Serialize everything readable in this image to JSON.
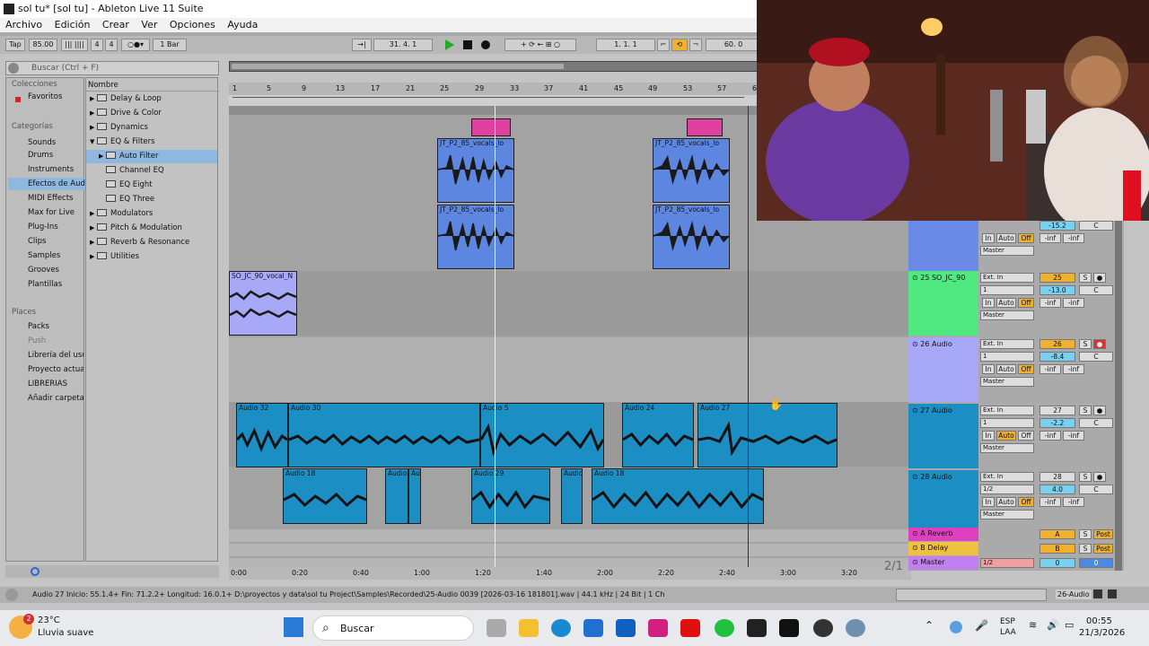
{
  "window": {
    "title": "sol tu*  [sol tu] - Ableton Live 11 Suite"
  },
  "menu": [
    "Archivo",
    "Edición",
    "Crear",
    "Ver",
    "Opciones",
    "Ayuda"
  ],
  "transport": {
    "tap": "Tap",
    "tempo": "85.00",
    "sig_num": "4",
    "sig_den": "4",
    "quant": "1 Bar",
    "position": "31.   4.   1",
    "loop_start": "1.   1.   1",
    "loop_len": "60.   0"
  },
  "browser": {
    "search_placeholder": "Buscar (Ctrl + F)",
    "collections_header": "Colecciones",
    "favorites": "Favoritos",
    "categories_header": "Categorías",
    "categories": [
      "Sounds",
      "Drums",
      "Instruments",
      "Efectos de Aud",
      "MIDI Effects",
      "Max for Live",
      "Plug-Ins",
      "Clips",
      "Samples",
      "Grooves",
      "Plantillas"
    ],
    "places_header": "Places",
    "places": [
      "Packs",
      "Push",
      "Librería del usu",
      "Proyecto actua",
      "LIBRERIAS",
      "Añadir carpeta..."
    ],
    "name_header": "Nombre",
    "items": [
      "Delay & Loop",
      "Drive & Color",
      "Dynamics",
      "EQ & Filters",
      "Auto Filter",
      "Channel EQ",
      "EQ Eight",
      "EQ Three",
      "Modulators",
      "Pitch & Modulation",
      "Reverb & Resonance",
      "Utilities"
    ]
  },
  "ruler": [
    "1",
    "5",
    "9",
    "13",
    "17",
    "21",
    "25",
    "29",
    "33",
    "37",
    "41",
    "45",
    "49",
    "53",
    "57",
    "6"
  ],
  "timeline": [
    "0:00",
    "0:20",
    "0:40",
    "1:00",
    "1:20",
    "1:40",
    "2:00",
    "2:20",
    "2:40",
    "3:00",
    "3:20"
  ],
  "clips": {
    "jt1": "JT_P2_85_vocals_lo",
    "jt2": "JT_P2_85_vocals_lo",
    "jt3": "JT_P2_85_vocals_lo",
    "jt4": "JT_P2_85_vocals_lo",
    "so": "SO_JC_90_vocal_N",
    "a32": "Audio 32",
    "a30": "Audio 30",
    "a5": "Audio 5",
    "a24": "Audio 24",
    "a27": "Audio 27",
    "a18a": "Audio 18",
    "a18b": "Audio 18",
    "au1": "Audio",
    "au2": "Au",
    "a29": "Audio 29",
    "au3": "Audio"
  },
  "mixer": {
    "tracks": [
      {
        "name": "25 SO_JC_90",
        "input": "Ext. In",
        "channel": "1",
        "monitor_in": "In",
        "monitor_auto": "Auto",
        "monitor_off": "Off",
        "output": "Master",
        "num": "25",
        "solo": "S",
        "vol": "-13.0",
        "pan": "C",
        "peak1": "-inf",
        "peak2": "-inf",
        "color": "#50e880"
      },
      {
        "name": "26 Audio",
        "input": "Ext. In",
        "channel": "1",
        "monitor_in": "In",
        "monitor_auto": "Auto",
        "monitor_off": "Off",
        "output": "Master",
        "num": "26",
        "solo": "S",
        "vol": "-8.4",
        "pan": "C",
        "peak1": "-inf",
        "peak2": "-inf",
        "color": "#a8a8f8"
      },
      {
        "name": "27 Audio",
        "input": "Ext. In",
        "channel": "1",
        "monitor_in": "In",
        "monitor_auto": "Auto",
        "monitor_off": "Off",
        "output": "Master",
        "num": "27",
        "solo": "S",
        "vol": "-2.2",
        "pan": "C",
        "peak1": "-inf",
        "peak2": "-inf",
        "color": "#1b8ec4"
      },
      {
        "name": "28 Audio",
        "input": "Ext. In",
        "channel": "1/2",
        "monitor_in": "In",
        "monitor_auto": "Auto",
        "monitor_off": "Off",
        "output": "Master",
        "num": "28",
        "solo": "S",
        "vol": "4.0",
        "pan": "C",
        "peak1": "-inf",
        "peak2": "-inf",
        "color": "#1b8ec4"
      }
    ],
    "prev": {
      "vol": "-15.2",
      "pan": "C",
      "in": "In",
      "auto": "Auto",
      "off": "Off",
      "peak1": "-inf",
      "peak2": "-inf",
      "output": "Master"
    },
    "returns": [
      {
        "name": "A Reverb",
        "letter": "A",
        "solo": "S",
        "post": "Post"
      },
      {
        "name": "B Delay",
        "letter": "B",
        "solo": "S",
        "post": "Post"
      }
    ],
    "master": {
      "name": "Master",
      "channel": "1/2",
      "vol": "0",
      "pan": "0"
    },
    "page": "2/1"
  },
  "status": {
    "text": "Audio 27  Inicio: 55.1.4+  Fin: 71.2.2+  Longitud: 16.0.1+  D:\\proyectos y data\\sol tu Project\\Samples\\Recorded\\25-Audio 0039 [2026-03-16 181801].wav | 44.1 kHz | 24 Bit | 1 Ch",
    "track": "26-Audio"
  },
  "taskbar": {
    "temp": "23°C",
    "weather": "Lluvia suave",
    "badge": "2",
    "search": "Buscar",
    "lang1": "ESP",
    "lang2": "LAA",
    "time": "00:55",
    "date": "21/3/2026"
  }
}
